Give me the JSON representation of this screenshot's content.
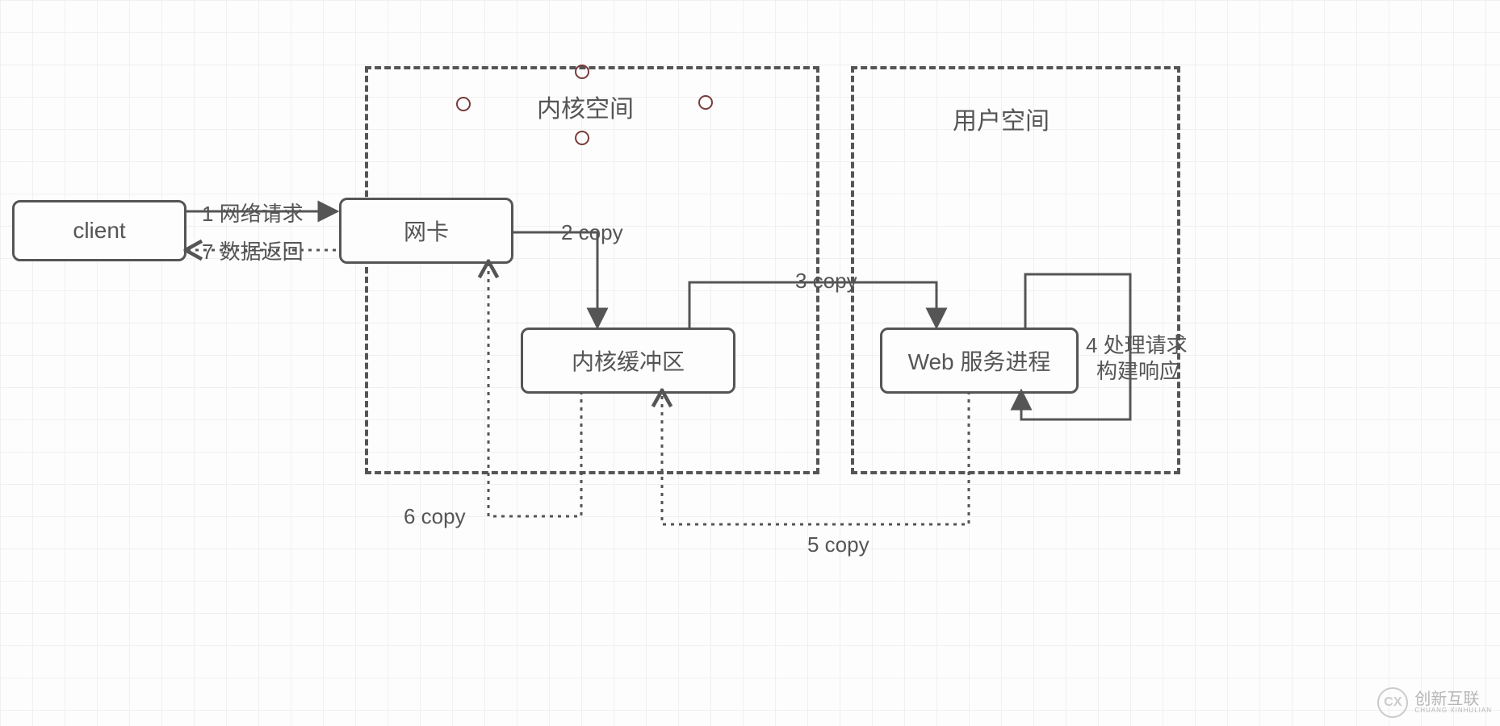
{
  "regions": {
    "kernel_space": "内核空间",
    "user_space": "用户空间"
  },
  "nodes": {
    "client": "client",
    "nic": "网卡",
    "kernel_buffer": "内核缓冲区",
    "web_process": "Web 服务进程"
  },
  "edges": {
    "e1": "1 网络请求",
    "e2": "2 copy",
    "e3": "3 copy",
    "e4a": "4 处理请求",
    "e4b": "构建响应",
    "e5": "5 copy",
    "e6": "6 copy",
    "e7": "7 数据返回"
  },
  "watermark": {
    "brand": "创新互联",
    "sub": "CHUANG XINHULIAN"
  }
}
